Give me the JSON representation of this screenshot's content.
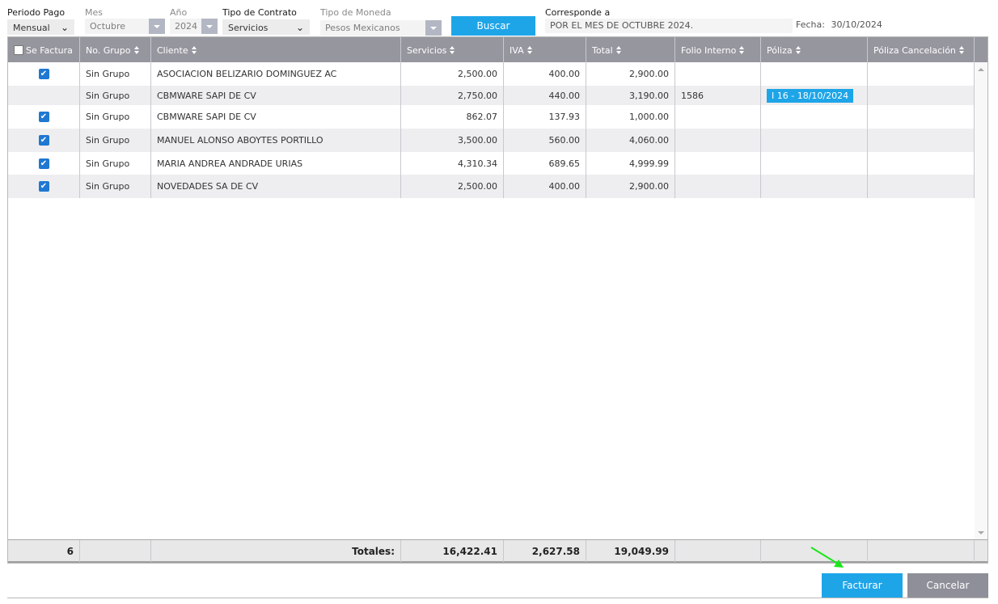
{
  "filters": {
    "periodo_label": "Periodo Pago",
    "periodo_value": "Mensual",
    "mes_label": "Mes",
    "mes_value": "Octubre",
    "anio_label": "Año",
    "anio_value": "2024",
    "tipo_contrato_label": "Tipo de Contrato",
    "tipo_contrato_value": "Servicios",
    "moneda_label": "Tipo de Moneda",
    "moneda_value": "Pesos Mexicanos",
    "buscar_label": "Buscar",
    "corresponde_label": "Corresponde a",
    "corresponde_value": "POR EL MES DE OCTUBRE 2024.",
    "fecha_label": "Fecha:",
    "fecha_value": "30/10/2024"
  },
  "table": {
    "headers": [
      "Se Factura",
      "No. Grupo",
      "Cliente",
      "Servicios",
      "IVA",
      "Total",
      "Folio Interno",
      "Póliza",
      "Póliza Cancelación"
    ],
    "rows": [
      {
        "checked": true,
        "grupo": "Sin Grupo",
        "cliente": "ASOCIACION BELIZARIO DOMINGUEZ AC",
        "servicios": "2,500.00",
        "iva": "400.00",
        "total": "2,900.00",
        "folio": "",
        "poliza": "",
        "cancelacion": ""
      },
      {
        "checked": false,
        "grupo": "Sin Grupo",
        "cliente": "CBMWARE SAPI DE CV",
        "servicios": "2,750.00",
        "iva": "440.00",
        "total": "3,190.00",
        "folio": "1586",
        "poliza": "I 16 - 18/10/2024",
        "cancelacion": ""
      },
      {
        "checked": true,
        "grupo": "Sin Grupo",
        "cliente": "CBMWARE SAPI DE CV",
        "servicios": "862.07",
        "iva": "137.93",
        "total": "1,000.00",
        "folio": "",
        "poliza": "",
        "cancelacion": ""
      },
      {
        "checked": true,
        "grupo": "Sin Grupo",
        "cliente": "MANUEL ALONSO ABOYTES PORTILLO",
        "servicios": "3,500.00",
        "iva": "560.00",
        "total": "4,060.00",
        "folio": "",
        "poliza": "",
        "cancelacion": ""
      },
      {
        "checked": true,
        "grupo": "Sin Grupo",
        "cliente": "MARIA ANDREA ANDRADE URIAS",
        "servicios": "4,310.34",
        "iva": "689.65",
        "total": "4,999.99",
        "folio": "",
        "poliza": "",
        "cancelacion": ""
      },
      {
        "checked": true,
        "grupo": "Sin Grupo",
        "cliente": "NOVEDADES SA DE CV",
        "servicios": "2,500.00",
        "iva": "400.00",
        "total": "2,900.00",
        "folio": "",
        "poliza": "",
        "cancelacion": ""
      }
    ],
    "totals": {
      "count": "6",
      "label": "Totales:",
      "servicios": "16,422.41",
      "iva": "2,627.58",
      "total": "19,049.99"
    }
  },
  "actions": {
    "facturar_label": "Facturar",
    "cancelar_label": "Cancelar"
  },
  "colors": {
    "accent": "#1ea5e8",
    "header_bg": "#96969f",
    "annotation_arrow": "#19e619"
  },
  "icons": {
    "check": "✔",
    "chevron": "chevron-down-icon",
    "sort": "sort-icon"
  }
}
